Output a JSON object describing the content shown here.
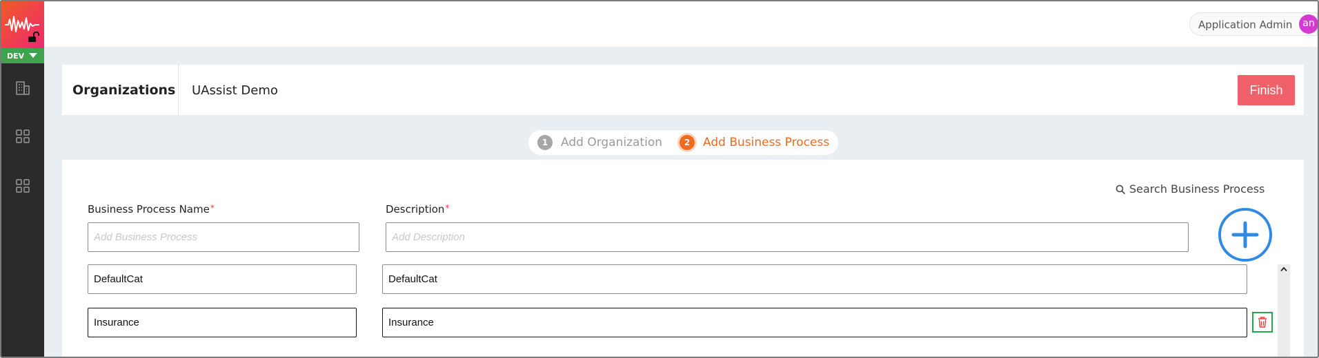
{
  "app": {
    "environment": "DEV",
    "user": {
      "name": "Application Admin",
      "initials": "an"
    }
  },
  "sidebar": {
    "icons": [
      "building-icon",
      "grid-icon",
      "grid-icon"
    ]
  },
  "org_bar": {
    "title": "Organizations",
    "organization_name": "UAssist Demo",
    "finish_label": "Finish"
  },
  "stepper": {
    "steps": [
      {
        "number": "1",
        "label": "Add Organization",
        "state": "done"
      },
      {
        "number": "2",
        "label": "Add Business Process",
        "state": "active"
      }
    ]
  },
  "form": {
    "search_label": "Search Business Process",
    "name_label": "Business Process Name",
    "description_label": "Description",
    "required_mark": "*",
    "name_placeholder": "Add Business Process",
    "description_placeholder": "Add Description"
  },
  "processes": [
    {
      "name": "DefaultCat",
      "description": "DefaultCat"
    },
    {
      "name": "Insurance",
      "description": "Insurance"
    }
  ],
  "colors": {
    "finish": "#f06068",
    "active_step": "#f06a1d",
    "add_button": "#2f8ae5",
    "env_badge": "#3fa34d",
    "delete_border": "#1faa4e",
    "delete_icon": "#e53935"
  }
}
